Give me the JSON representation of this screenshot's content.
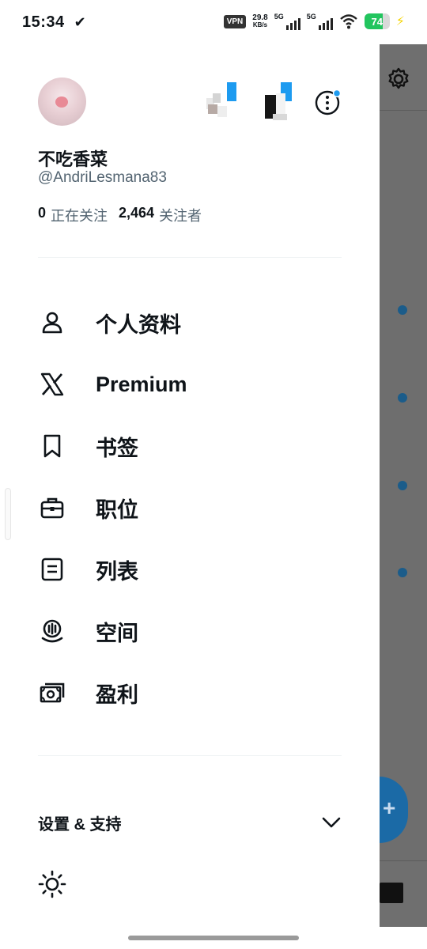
{
  "status_bar": {
    "time": "15:34",
    "tick": "✔",
    "vpn": "VPN",
    "speed_value": "29.8",
    "speed_unit": "KB/s",
    "net1": "5G",
    "net2": "5G",
    "battery": "74",
    "battery_level": 0.74,
    "charging_icon": "bolt-icon"
  },
  "profile": {
    "display_name": "不吃香菜",
    "handle": "@AndriLesmana83",
    "following_count": "0",
    "following_label": "正在关注",
    "followers_count": "2,464",
    "followers_label": "关注者"
  },
  "menu": {
    "items": [
      {
        "label": "个人资料",
        "icon": "person-icon"
      },
      {
        "label": "Premium",
        "icon": "x-logo-icon"
      },
      {
        "label": "书签",
        "icon": "bookmark-icon"
      },
      {
        "label": "职位",
        "icon": "briefcase-icon"
      },
      {
        "label": "列表",
        "icon": "list-icon"
      },
      {
        "label": "空间",
        "icon": "spaces-icon"
      },
      {
        "label": "盈利",
        "icon": "money-icon"
      }
    ]
  },
  "settings": {
    "label": "设置 & 支持",
    "toggle_icon": "chevron-down-icon",
    "theme_icon": "sun-icon"
  },
  "colors": {
    "accent": "#1d9bf0",
    "text": "#0f1419",
    "secondary_text": "#536471",
    "overlay": "#6e6e6e"
  }
}
